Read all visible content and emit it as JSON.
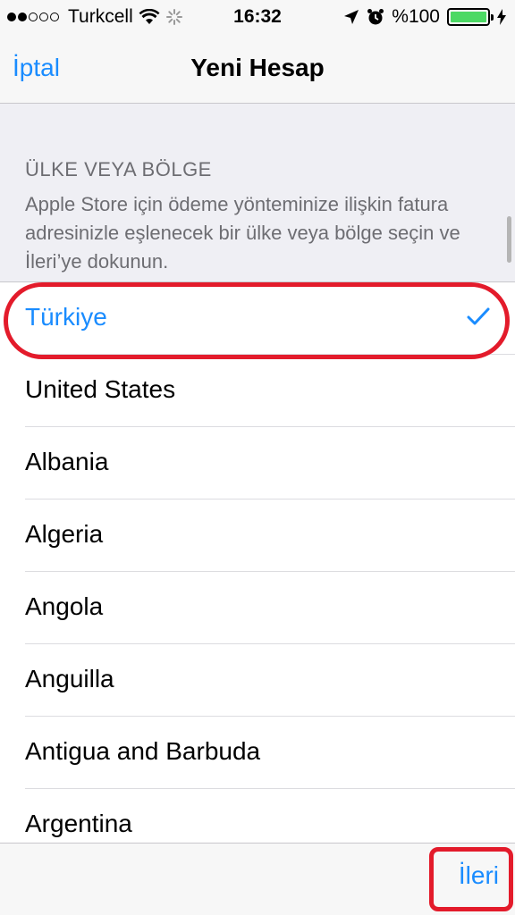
{
  "status": {
    "carrier": "Turkcell",
    "time": "16:32",
    "battery": "%100",
    "signal_bars_filled": 2,
    "signal_bars_total": 5,
    "battery_level": 1.0,
    "accent_green": "#4cd964"
  },
  "nav": {
    "cancel": "İptal",
    "title": "Yeni Hesap"
  },
  "section": {
    "header": "ÜLKE VEYA BÖLGE",
    "description": "Apple Store için ödeme yönteminize ilişkin fatura adresinizle eşlenecek bir ülke veya bölge seçin ve İleri’ye dokunun."
  },
  "countries": [
    {
      "name": "Türkiye",
      "selected": true
    },
    {
      "name": "United States"
    },
    {
      "name": "Albania"
    },
    {
      "name": "Algeria"
    },
    {
      "name": "Angola"
    },
    {
      "name": "Anguilla"
    },
    {
      "name": "Antigua and Barbuda"
    },
    {
      "name": "Argentina"
    }
  ],
  "toolbar": {
    "next": "İleri"
  },
  "colors": {
    "tint": "#1a8cff",
    "highlight": "#e31b2b"
  },
  "icons": {
    "wifi": "wifi-icon",
    "activity": "activity-spinner-icon",
    "location": "location-arrow-icon",
    "alarm": "alarm-clock-icon",
    "charging": "charging-bolt-icon",
    "checkmark": "checkmark-icon"
  }
}
